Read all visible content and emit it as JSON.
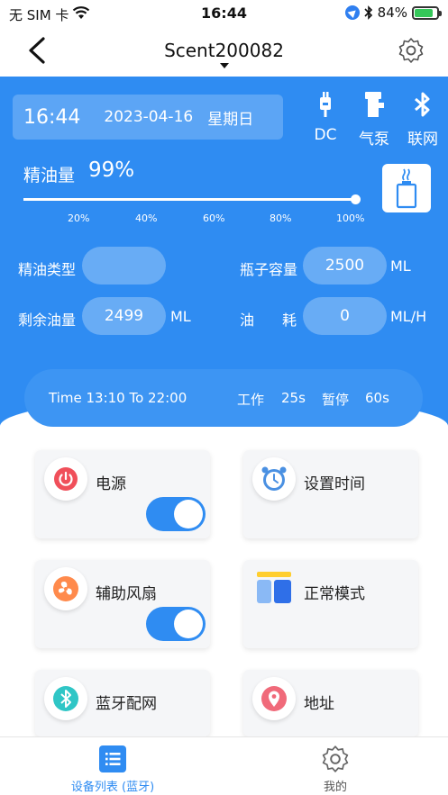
{
  "status_bar": {
    "carrier": "无 SIM 卡",
    "time": "16:44",
    "battery": "84%",
    "battery_level": 0.84
  },
  "nav": {
    "title": "Scent200082"
  },
  "device": {
    "clock": "16:44",
    "date": "2023-04-16",
    "weekday": "星期日",
    "indicators": [
      {
        "icon": "plug-icon",
        "label": "DC"
      },
      {
        "icon": "air-pump-icon",
        "label": "气泵"
      },
      {
        "icon": "bluetooth-icon",
        "label": "联网"
      }
    ]
  },
  "oil": {
    "label": "精油量",
    "percent": "99%",
    "level": 0.99,
    "ticks": [
      "20%",
      "40%",
      "60%",
      "80%",
      "100%"
    ]
  },
  "fields": {
    "oil_type_label": "精油类型",
    "oil_type_value": "",
    "bottle_capacity_label": "瓶子容量",
    "bottle_capacity_value": "2500",
    "bottle_capacity_unit": "ML",
    "remaining_label": "剩余油量",
    "remaining_value": "2499",
    "remaining_unit": "ML",
    "consumption_label_1": "油",
    "consumption_label_2": "耗",
    "consumption_value": "0",
    "consumption_unit": "ML/H"
  },
  "schedule": {
    "time_range": "Time 13:10 To 22:00",
    "work_label": "工作",
    "work_value": "25s",
    "pause_label": "暂停",
    "pause_value": "60s"
  },
  "cards": {
    "power": {
      "label": "电源",
      "on": true
    },
    "set_time": {
      "label": "设置时间"
    },
    "fan": {
      "label": "辅助风扇",
      "on": true
    },
    "mode": {
      "label": "正常模式"
    },
    "bt_pair": {
      "label": "蓝牙配网"
    },
    "address": {
      "label": "地址"
    }
  },
  "tabs": [
    {
      "label": "设备列表 (蓝牙)",
      "icon": "device-list-icon",
      "active": true
    },
    {
      "label": "我的",
      "icon": "gear-icon",
      "active": false
    }
  ],
  "colors": {
    "accent": "#2f8cf2",
    "tab_active": "#2f8cf2",
    "tab_inactive": "#555555"
  }
}
